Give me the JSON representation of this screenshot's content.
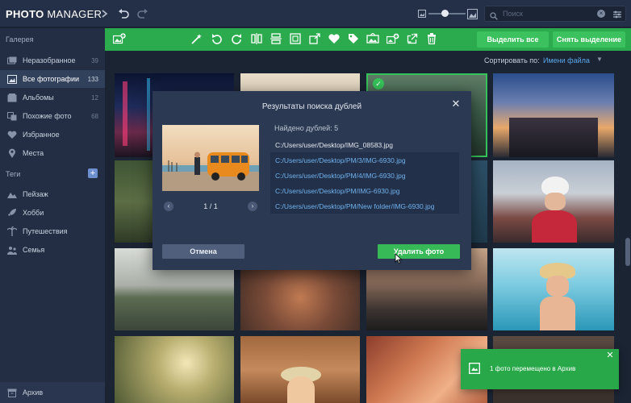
{
  "app": {
    "title_bold": "PHOTO",
    "title_light": " MANAGER"
  },
  "search": {
    "placeholder": "Поиск"
  },
  "sidebar": {
    "gallery_heading": "Галерея",
    "items": [
      {
        "label": "Неразобранное",
        "count": "39"
      },
      {
        "label": "Все фотографии",
        "count": "133"
      },
      {
        "label": "Альбомы",
        "count": "12"
      },
      {
        "label": "Похожие фото",
        "count": "68"
      },
      {
        "label": "Избранное",
        "count": ""
      },
      {
        "label": "Места",
        "count": ""
      }
    ],
    "tags_heading": "Теги",
    "tags": [
      {
        "label": "Пейзаж"
      },
      {
        "label": "Хобби"
      },
      {
        "label": "Путешествия"
      },
      {
        "label": "Семья"
      }
    ],
    "archive_label": "Архив"
  },
  "toolbar": {
    "select_all": "Выделить все",
    "deselect": "Снять выделение"
  },
  "sort": {
    "label": "Сортировать по:",
    "value": "Имени файла"
  },
  "dialog": {
    "title": "Результаты поиска дублей",
    "found_label": "Найдено дублей: 5",
    "pager_text": "1 / 1",
    "original_path": "C:/Users/user/Desktop/IMG_08583.jpg",
    "duplicates": [
      "C:/Users/user/Desktop/PM/3/IMG-6930.jpg",
      "C:/Users/user/Desktop/PM/4/IMG-6930.jpg",
      "C:/Users/user/Desktop/PM/IMG-6930.jpg",
      "C:/Users/user/Desktop/PM/New folder/IMG-6930.jpg"
    ],
    "cancel_label": "Отмена",
    "delete_label": "Удалить фото"
  },
  "toast": {
    "text": "1 фото перемещено в Архив"
  },
  "colors": {
    "accent_green": "#2bab4d",
    "link_blue": "#5aa9ea",
    "panel_dark": "#232e44"
  }
}
